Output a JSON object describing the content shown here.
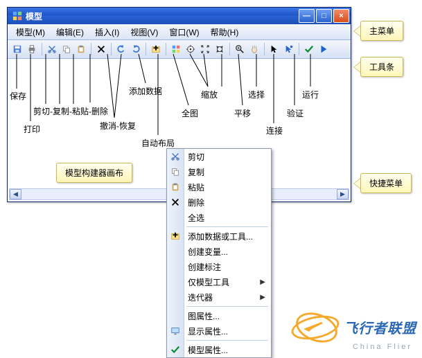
{
  "window": {
    "title": "模型"
  },
  "menubar": {
    "items": [
      "模型(M)",
      "编辑(E)",
      "插入(I)",
      "视图(V)",
      "窗口(W)",
      "帮助(H)"
    ]
  },
  "tool_labels": {
    "save": "保存",
    "print": "打印",
    "cut_copy_paste_delete": "剪切-复制-粘贴-删除",
    "undo_redo": "撤消-恢复",
    "add_data": "添加数据",
    "auto_layout": "自动布局",
    "full_extent": "全图",
    "zoom": "缩放",
    "pan": "平移",
    "select": "选择",
    "connect": "连接",
    "validate": "验证",
    "run": "运行"
  },
  "canvas_note": "模型构建器画布",
  "callouts": {
    "main_menu": "主菜单",
    "toolbar": "工具条",
    "context_menu": "快捷菜单"
  },
  "context_menu": {
    "cut": "剪切",
    "copy": "复制",
    "paste": "粘贴",
    "delete": "删除",
    "select_all": "全选",
    "add_data_tool": "添加数据或工具...",
    "create_variable": "创建变量...",
    "create_label": "创建标注",
    "model_only_tools": "仅模型工具",
    "iterators": "迭代器",
    "diagram_props": "图属性...",
    "display_props": "显示属性...",
    "model_props": "模型属性..."
  },
  "watermark": {
    "brand": "飞行者联盟",
    "sub": "China Flier"
  }
}
